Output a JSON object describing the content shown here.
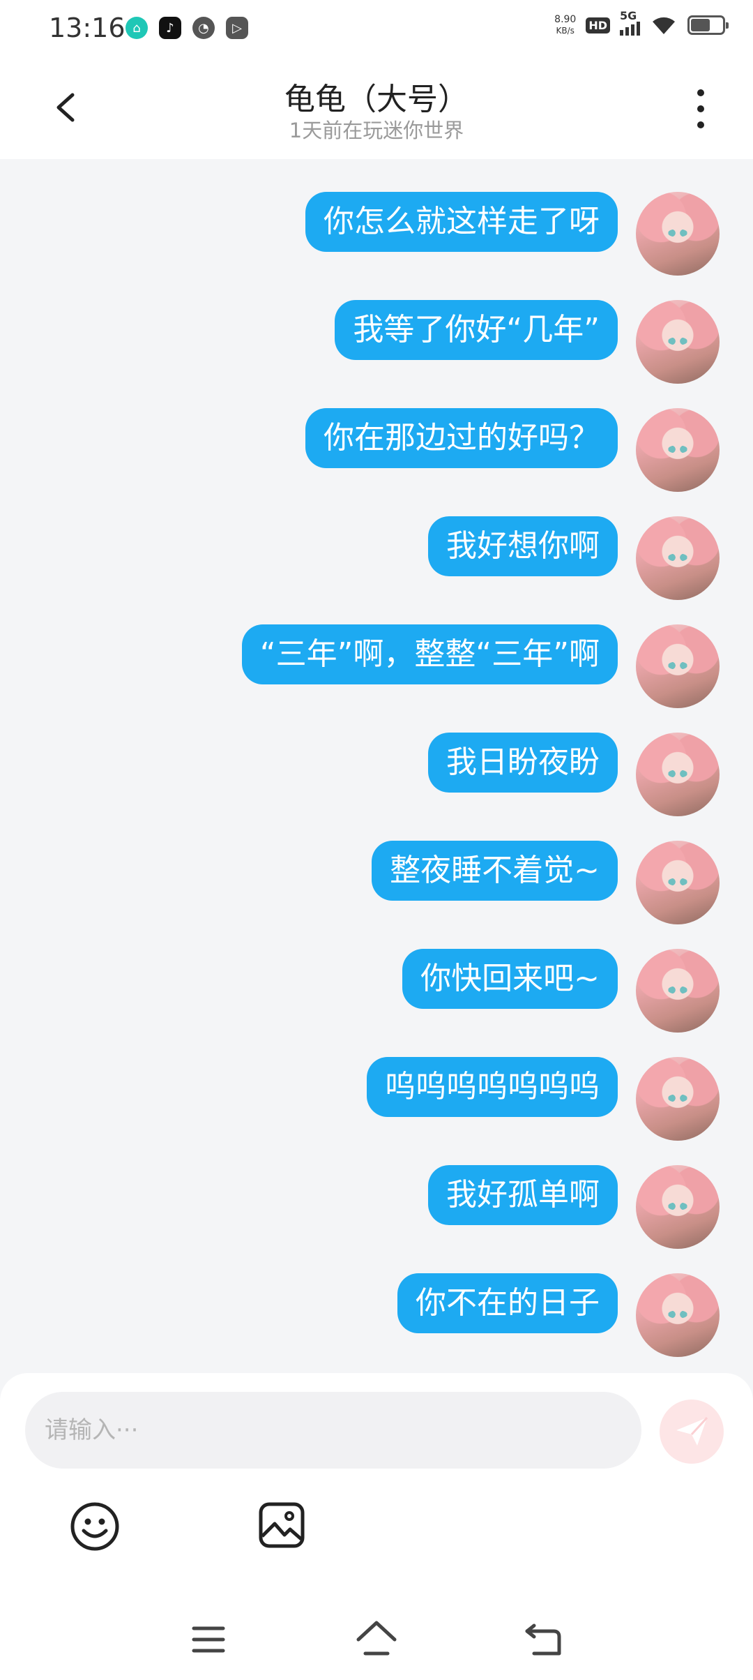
{
  "status_bar": {
    "time": "13:16",
    "net_speed_value": "8.90",
    "net_speed_unit": "KB/s",
    "hd_badge": "HD",
    "network": "5G",
    "battery_level": 0.56,
    "app_icons": [
      "home-app-icon",
      "tiktok-icon",
      "gauge-icon",
      "play-icon"
    ]
  },
  "header": {
    "title": "龟龟（大号）",
    "subtitle": "1天前在玩迷你世界"
  },
  "messages": [
    {
      "text": "你怎么就这样走了呀"
    },
    {
      "text": "我等了你好“几年”"
    },
    {
      "text": "你在那边过的好吗？"
    },
    {
      "text": "我好想你啊"
    },
    {
      "text": "“三年”啊，整整“三年”啊"
    },
    {
      "text": "我日盼夜盼"
    },
    {
      "text": "整夜睡不着觉~"
    },
    {
      "text": "你快回来吧~"
    },
    {
      "text": "呜呜呜呜呜呜呜"
    },
    {
      "text": "我好孤单啊"
    },
    {
      "text": "你不在的日子"
    }
  ],
  "composer": {
    "placeholder": "请输入···",
    "value": ""
  },
  "colors": {
    "bubble": "#1daaf2",
    "background": "#f4f5f7",
    "send_button": "#fde5e6"
  }
}
